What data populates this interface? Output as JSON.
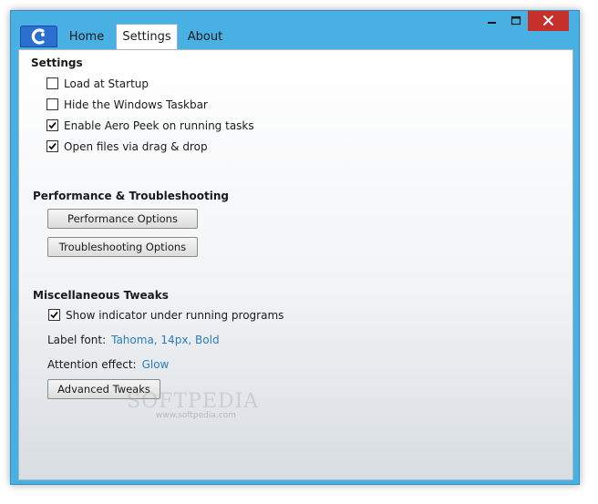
{
  "tabs": {
    "home": "Home",
    "settings": "Settings",
    "about": "About"
  },
  "settings": {
    "title": "Settings",
    "options": [
      {
        "label": "Load at Startup",
        "checked": false
      },
      {
        "label": "Hide the Windows Taskbar",
        "checked": false
      },
      {
        "label": "Enable Aero Peek on running tasks",
        "checked": true
      },
      {
        "label": "Open files via drag & drop",
        "checked": true
      }
    ]
  },
  "performance": {
    "title": "Performance & Troubleshooting",
    "performance_button": "Performance Options",
    "troubleshooting_button": "Troubleshooting Options"
  },
  "misc": {
    "title": "Miscellaneous Tweaks",
    "show_indicator": {
      "label": "Show indicator under running programs",
      "checked": true
    },
    "label_font_caption": "Label font:",
    "label_font_value": "Tahoma, 14px, Bold",
    "attention_caption": "Attention effect:",
    "attention_value": "Glow",
    "advanced_button": "Advanced Tweaks"
  },
  "watermark": {
    "text": "SOFTPEDIA",
    "url": "www.softpedia.com"
  },
  "colors": {
    "accent": "#49b0e3",
    "link": "#2a7bc0",
    "close": "#c7302a"
  }
}
